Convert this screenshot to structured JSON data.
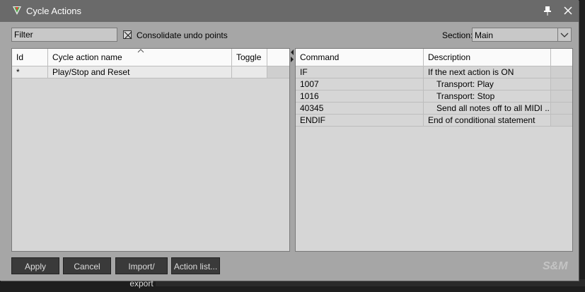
{
  "window": {
    "title": "Cycle Actions"
  },
  "toolbar": {
    "filter_text": "Filter",
    "consolidate_label": "Consolidate undo points",
    "consolidate_checked": true,
    "section_label": "Section:",
    "section_value": "Main"
  },
  "left_table": {
    "headers": [
      "Id",
      "Cycle action name",
      "Toggle"
    ],
    "rows": [
      {
        "id": "*",
        "name": "Play/Stop and Reset",
        "toggle": ""
      }
    ]
  },
  "right_table": {
    "headers": [
      "Command",
      "Description"
    ],
    "rows": [
      {
        "command": "IF",
        "description": "If the next action is ON"
      },
      {
        "command": "1007",
        "description": "Transport: Play"
      },
      {
        "command": "1016",
        "description": "Transport: Stop"
      },
      {
        "command": "40345",
        "description": "Send all notes off to all MIDI ..."
      },
      {
        "command": "ENDIF",
        "description": "End of conditional statement"
      }
    ]
  },
  "buttons": {
    "apply": "Apply",
    "cancel": "Cancel",
    "import_export": "Import/ export",
    "action_list": "Action list..."
  },
  "logo": "S&M"
}
